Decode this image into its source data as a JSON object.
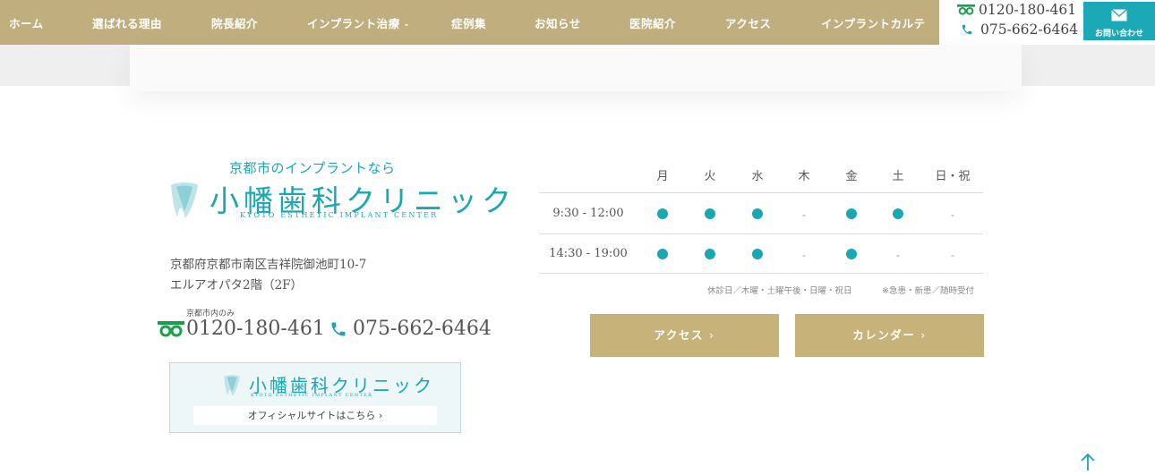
{
  "nav": {
    "items": [
      {
        "label": "ホーム"
      },
      {
        "label": "選ばれる理由"
      },
      {
        "label": "院長紹介"
      },
      {
        "label": "インプラント治療"
      },
      {
        "label": "症例集"
      },
      {
        "label": "お知らせ"
      },
      {
        "label": "医院紹介"
      },
      {
        "label": "アクセス"
      },
      {
        "label": "インプラントカルテ"
      }
    ],
    "tel_freedial": "0120-180-461",
    "tel_phone": "075-662-6464",
    "contact_label": "お問い合わせ"
  },
  "clinic": {
    "tagline": "京都市のインプラントなら",
    "name": "小幡歯科クリニック",
    "name_en": "KYOTO ESTHETIC IMPLANT CENTER",
    "address_line1": "京都府京都市南区吉祥院御池町10-7",
    "address_line2": "エルアオパタ2階（2F）",
    "local_only_note": "京都市内のみ",
    "tel_freedial": "0120-180-461",
    "tel_phone": "075-662-6464",
    "banner": {
      "name": "小幡歯科クリニック",
      "name_en": "KYOTO ESTHETIC IMPLANT CENTER",
      "link_label": "オフィシャルサイトはこちら"
    }
  },
  "schedule": {
    "days": [
      "月",
      "火",
      "水",
      "木",
      "金",
      "土",
      "日・祝"
    ],
    "rows": [
      {
        "time": "9:30 - 12:00",
        "open": [
          true,
          true,
          true,
          false,
          true,
          true,
          false
        ]
      },
      {
        "time": "14:30 - 19:00",
        "open": [
          true,
          true,
          true,
          false,
          true,
          false,
          false
        ]
      }
    ],
    "closed_mark": "-",
    "note_closed": "休診日／木曜・土曜午後・日曜・祝日",
    "note_emergency": "※急患・新患／随時受付"
  },
  "buttons": {
    "access": "アクセス",
    "calendar": "カレンダー"
  },
  "colors": {
    "nav_gold": "#bfae7e",
    "button_gold": "#c7b37a",
    "teal": "#1aa6b3",
    "freedial_green": "#19a04b"
  },
  "icons": {
    "freedial": "freedial-icon",
    "phone": "phone-icon",
    "mail": "mail-icon",
    "tooth": "tooth-logo-icon",
    "back_to_top": "arrow-up-icon"
  }
}
